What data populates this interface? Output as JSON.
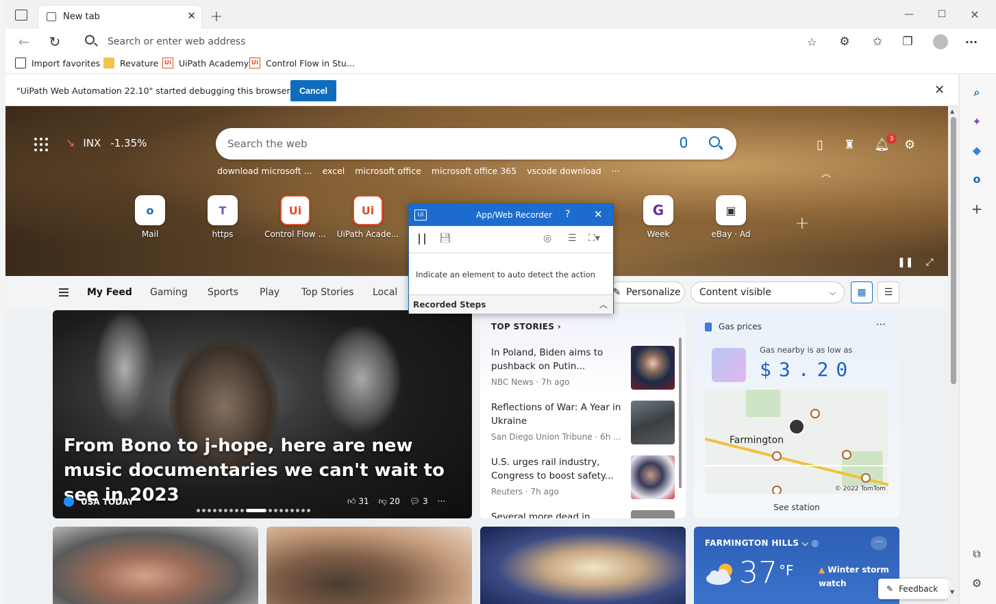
{
  "browser": {
    "tab_title": "New tab",
    "address_placeholder": "Search or enter web address"
  },
  "favorites": [
    {
      "label": "Import favorites",
      "icon": "import-icon"
    },
    {
      "label": "Revature",
      "icon": "folder-icon"
    },
    {
      "label": "UiPath Academy",
      "icon": "uipath-icon"
    },
    {
      "label": "Control Flow in Stu...",
      "icon": "uipath-icon"
    }
  ],
  "infobar": {
    "message": "\"UiPath Web Automation 22.10\" started debugging this browser",
    "cancel_label": "Cancel"
  },
  "hero": {
    "stock_symbol": "INX",
    "stock_change": "-1.35%",
    "search_placeholder": "Search the web",
    "trending": [
      "download microsoft ...",
      "excel",
      "microsoft office",
      "microsoft office 365",
      "vscode download",
      "···"
    ],
    "notification_count": "3",
    "quick_links": [
      {
        "label": "Mail",
        "glyph": "o",
        "color": "#0f6cbd"
      },
      {
        "label": "https",
        "glyph": "T",
        "color": "#5b5fc7"
      },
      {
        "label": "Control Flow ...",
        "glyph": "Ui",
        "color": "#e04d2a"
      },
      {
        "label": "UiPath Acade...",
        "glyph": "Ui",
        "color": "#e04d2a"
      },
      {
        "label": "Week",
        "glyph": "G",
        "color": "#6b2fa3"
      },
      {
        "label": "eBay · Ad",
        "glyph": "▣",
        "color": "#333"
      }
    ]
  },
  "feednav": {
    "tabs": [
      "My Feed",
      "Gaming",
      "Sports",
      "Play",
      "Top Stories",
      "Local"
    ],
    "personalize_label": "Personalize",
    "content_visibility": "Content visible"
  },
  "bigcard": {
    "headline": "From Bono to j-hope, here are new music documentaries we can't wait to see in 2023",
    "source": "USA TODAY",
    "likes": "31",
    "dislikes": "20",
    "comments": "3",
    "more": "···"
  },
  "top_stories": {
    "header": "TOP STORIES",
    "items": [
      {
        "title": "In Poland, Biden aims to pushback on Putin...",
        "source": "NBC News · 7h ago"
      },
      {
        "title": "Reflections of War: A Year in Ukraine",
        "source": "San Diego Union Tribune · 6h ..."
      },
      {
        "title": "U.S. urges rail industry, Congress to boost safety...",
        "source": "Reuters · 7h ago"
      },
      {
        "title": "Several more dead in",
        "source": ""
      }
    ]
  },
  "gas": {
    "header": "Gas prices",
    "more": "···",
    "low_label": "Gas nearby is as low as",
    "price": "$3.20",
    "city": "Farmington",
    "map_copyright": "© 2022 TomTom",
    "see_station": "See station"
  },
  "weather": {
    "location": "FARMINGTON HILLS",
    "more": "···",
    "temperature": "37",
    "unit": "°F",
    "alert": "Winter storm watch"
  },
  "feedback_label": "Feedback",
  "recorder": {
    "title": "App/Web Recorder",
    "help": "?",
    "hint": "Indicate an element to auto detect the action",
    "recorded_steps": "Recorded Steps"
  }
}
